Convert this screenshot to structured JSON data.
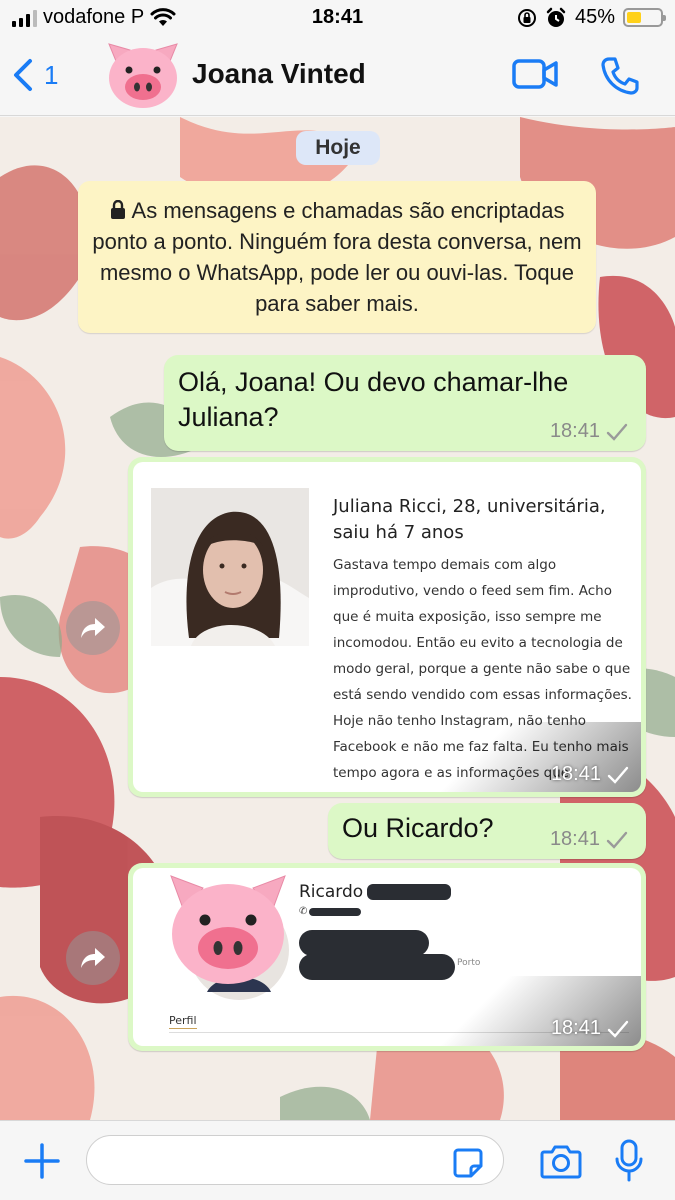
{
  "status_bar": {
    "carrier": "vodafone P",
    "time": "18:41",
    "battery": "45%",
    "battery_level": 0.45
  },
  "header": {
    "back_count": "1",
    "contact_name": "Joana Vinted",
    "icons": [
      "back-chevron-icon",
      "pig-avatar",
      "video-call-icon",
      "phone-icon"
    ]
  },
  "chat": {
    "date_label": "Hoje",
    "encryption_notice": "As mensagens e chamadas são encriptadas ponto a ponto. Ninguém fora desta conversa, nem mesmo o WhatsApp, pode ler ou ouvi-las. Toque para saber mais.",
    "messages": [
      {
        "type": "text",
        "text": "Olá, Joana! Ou devo chamar-lhe Juliana?",
        "time": "18:41"
      },
      {
        "type": "image",
        "time": "18:41",
        "card_title": "Juliana Ricci, 28, universitária, saiu há 7 anos",
        "card_body": "Gastava tempo demais com algo improdutivo, vendo o feed sem fim. Acho que é muita exposição, isso sempre me incomodou. Então eu evito a tecnologia de modo geral, porque a gente não sabe o que está sendo vendido com essas informações. Hoje não tenho Instagram, não tenho Facebook e não me faz falta. Eu tenho mais tempo agora e as informações que realmente importam chegam por outros meios\""
      },
      {
        "type": "text",
        "text": "Ou Ricardo?",
        "time": "18:41"
      },
      {
        "type": "image",
        "time": "18:41",
        "profile_name": "Ricardo",
        "location": "Porto",
        "tab_label": "Perfil"
      }
    ]
  },
  "composer": {
    "placeholder": "",
    "icons": [
      "plus-icon",
      "sticker-icon",
      "camera-icon",
      "microphone-icon"
    ]
  },
  "colors": {
    "accent": "#1a7cf5",
    "outgoing_bubble": "#dcf8c6",
    "system_notice": "#fdf4c5",
    "date_pill": "#dde7f8"
  }
}
